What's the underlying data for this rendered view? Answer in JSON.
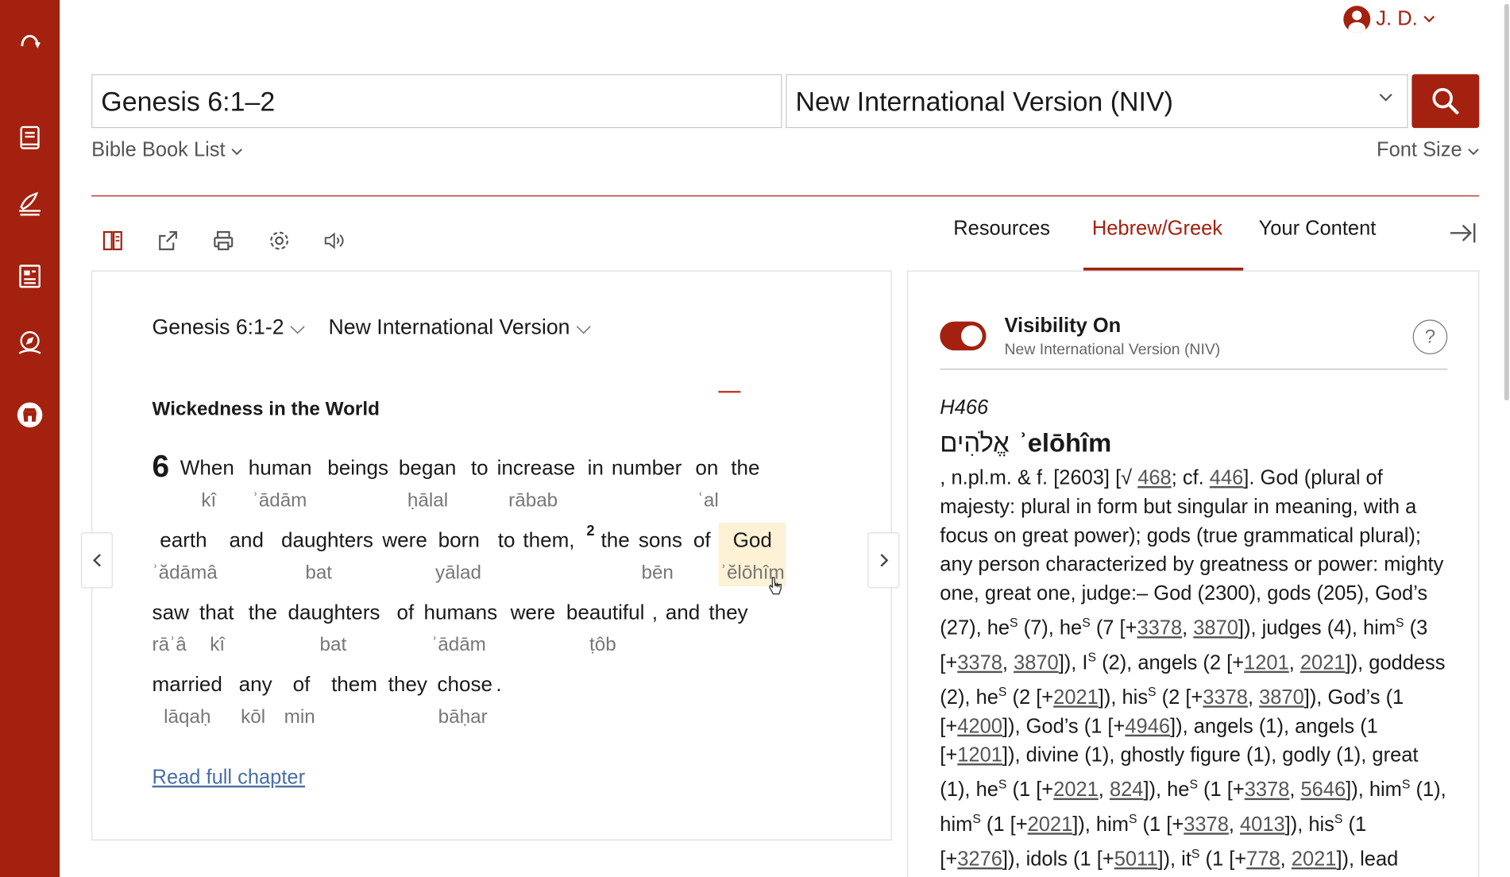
{
  "user": {
    "name": "J. D."
  },
  "search": {
    "reference": "Genesis 6:1–2",
    "version": "New International Version (NIV)"
  },
  "links": {
    "book_list": "Bible Book List",
    "font_size": "Font Size"
  },
  "tabs": [
    {
      "label": "Resources"
    },
    {
      "label": "Hebrew/Greek"
    },
    {
      "label": "Your Content"
    }
  ],
  "passage": {
    "reference": "Genesis 6:1-2",
    "version": "New International Version",
    "heading": "Wickedness in the World",
    "verse1_number": "6",
    "verse2_number": "2",
    "words": {
      "l1": [
        "When",
        "human",
        "beings",
        "began",
        "to",
        "increase",
        "in",
        "number",
        "on",
        "the"
      ],
      "t1": [
        "kî",
        "ʾādām",
        "ḥālal",
        "rābab",
        "ʿal"
      ],
      "l2": [
        "earth",
        "and",
        "daughters",
        "were",
        "born",
        "to",
        "them,",
        "the",
        "sons",
        "of",
        "God"
      ],
      "t2": [
        "ʾădāmâ",
        "bat",
        "yālad",
        "bēn",
        "ʾĕlōhîm"
      ],
      "l3": [
        "saw",
        "that",
        "the",
        "daughters",
        "of",
        "humans",
        "were",
        "beautiful",
        ",",
        "and",
        "they"
      ],
      "t3": [
        "rāʾâ",
        "kî",
        "bat",
        "ʾādām",
        "ṭôb"
      ],
      "l4": [
        "married",
        "any",
        "of",
        "them",
        "they",
        "chose",
        "."
      ],
      "t4": [
        "lāqaḥ",
        "kōl",
        "min",
        "bāḥar"
      ]
    },
    "read_full": "Read full chapter"
  },
  "lexicon": {
    "visibility_title": "Visibility On",
    "visibility_sub": "New International Version (NIV)",
    "help": "?",
    "strongs": "H466",
    "hebrew": "אֱלֹהִים",
    "translit": "ʾelōhîm",
    "body": {
      "p1": ", n.pl.m. & f. [2603] [√ ",
      "r468": "468",
      "p2": "; cf. ",
      "r446": "446",
      "p3": "]. God (plural of majesty: plural in form but singular in meaning, with a focus on great power); gods (true grammatical plural); any person characterized by greatness or power: mighty one, great one, judge:– God (2300), gods (205), God’s (27), he",
      "s1": "S",
      "p4": " (7), he",
      "s2": "S",
      "p5": " (7 [+",
      "a1": "3378",
      "p6": ", ",
      "a2": "3870",
      "p7": "]), judges (4), him",
      "s3": "S",
      "p8": " (3 [+",
      "a3": "3378",
      "p9": ", ",
      "a4": "3870",
      "p10": "]), I",
      "s4": "S",
      "p11": " (2), angels (2 [+",
      "a5": "1201",
      "p12": ", ",
      "a6": "2021",
      "p13": "]), goddess (2), he",
      "s5": "S",
      "p14": " (2 [+",
      "a7": "2021",
      "p15": "]), his",
      "s6": "S",
      "p16": " (2 [+",
      "a8": "3378",
      "p17": ", ",
      "a9": "3870",
      "p18": "]), God’s (1 [+",
      "a10": "4200",
      "p19": "]), God’s (1 [+",
      "a11": "4946",
      "p20": "]), angels (1), angels (1 [+",
      "a12": "1201",
      "p21": "]), divine (1), ghostly figure (1), godly (1), great (1), he",
      "s7": "S",
      "p22": " (1 [+",
      "a13": "2021",
      "p23": ", ",
      "a14": "824",
      "p24": "]), he",
      "s8": "S",
      "p25": " (1 [+",
      "a15": "3378",
      "p26": ", ",
      "a16": "5646",
      "p27": "]), him",
      "s9": "S",
      "p28": " (1), him",
      "s10": "S",
      "p29": " (1 [+",
      "a17": "2021",
      "p30": "]), him",
      "s11": "S",
      "p31": " (1 [+",
      "a18": "3378",
      "p32": ", ",
      "a19": "4013",
      "p33": "]), his",
      "s12": "S",
      "p34": " (1 [+",
      "a20": "3276",
      "p35": "]), idols (1 [+",
      "a21": "5011",
      "p36": "]), it",
      "s13": "S",
      "p37": " (1 [+",
      "a22": "778",
      "p38": ", ",
      "a23": "2021",
      "p39": "]), lead"
    }
  },
  "colors": {
    "brand": "#a4210f",
    "highlight": "#fdf2d6"
  }
}
